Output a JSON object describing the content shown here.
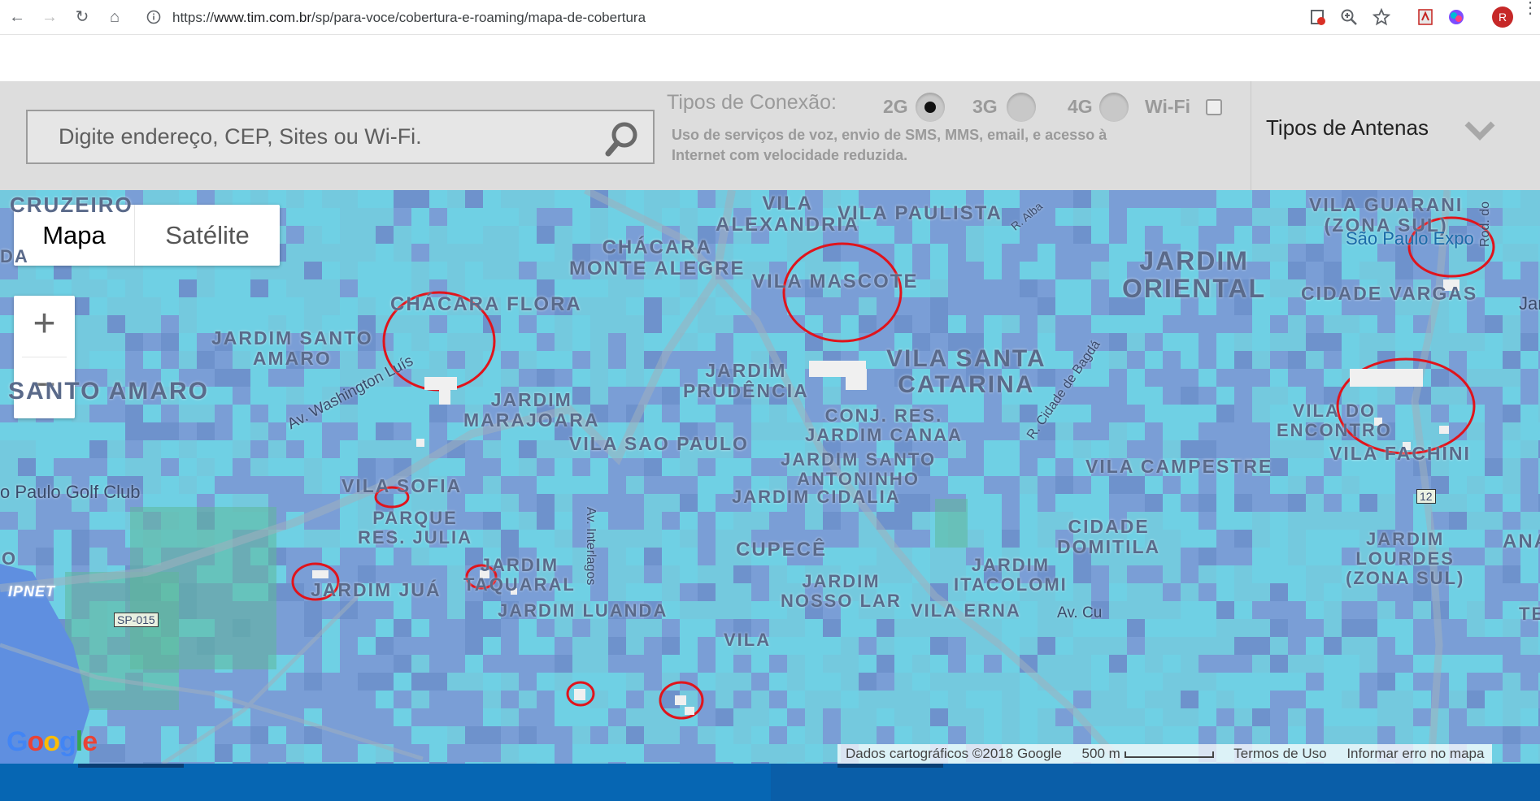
{
  "browser": {
    "url_prefix": "https://",
    "url_host": "www.tim.com.br",
    "url_path": "/sp/para-voce/cobertura-e-roaming/mapa-de-cobertura",
    "profile_initial": "R"
  },
  "search": {
    "placeholder": "Digite endereço, CEP, Sites ou Wi-Fi."
  },
  "connection": {
    "title": "Tipos de Conexão:",
    "options": [
      "2G",
      "3G",
      "4G",
      "Wi-Fi"
    ],
    "selected": "2G",
    "description": "Uso de serviços de voz, envio de SMS, MMS, email, e acesso à Internet com velocidade reduzida."
  },
  "antenas": {
    "label": "Tipos de Antenas"
  },
  "map": {
    "type_map": "Mapa",
    "type_satellite": "Satélite",
    "zoom_in": "+",
    "zoom_out": "−",
    "labels": [
      "CRUZEIRO",
      "VILA ALEXANDRIA",
      "VILA PAULISTA",
      "VILA GUARANI (ZONA SUL)",
      "CHÁCARA MONTE ALEGRE",
      "VILA MASCOTE",
      "JARDIM ORIENTAL",
      "São Paulo Expo",
      "CIDADE VARGAS",
      "CHÁCARA FLORA",
      "JARDIM SANTO AMARO",
      "SANTO AMARO",
      "JARDIM PRUDÊNCIA",
      "VILA SANTA CATARINA",
      "JARDIM MARAJOARA",
      "CONJ. RES. JARDIM CANAA",
      "VILA DO ENCONTRO",
      "VILA SAO PAULO",
      "VILA FACHINI",
      "JARDIM SANTO ANTONINHO",
      "VILA CAMPESTRE",
      "VILA SOFIA",
      "JARDIM CIDALIA",
      "PARQUE RES. JULIA",
      "CIDADE DOMITILA",
      "CUPECÊ",
      "JARDIM LOURDES (ZONA SUL)",
      "JARDIM TAQUARAL",
      "JARDIM JUÁ",
      "JARDIM NOSSO LAR",
      "JARDIM ITACOLOMI",
      "JARDIM LUANDA",
      "VILA ERNA",
      "o Paulo Golf Club",
      "Av. Washington Luís",
      "Av. Interlagos",
      "R. Cidade de Bagdá",
      "R. Alba",
      "Rod. do",
      "SP-015",
      "12",
      "IPNET",
      "Jar",
      "ANA",
      "TE",
      "VILA",
      "Av. Cu",
      "DA",
      "O"
    ],
    "attribution": "Dados cartográficos ©2018 Google",
    "scale": "500 m",
    "terms": "Termos de Uso",
    "report": "Informar erro no mapa",
    "logo": "Google"
  },
  "colors": {
    "coverage": "#6ec9e0",
    "base": "#7a9ed6",
    "annotation": "#e0141c",
    "footer": "#0666b3"
  }
}
